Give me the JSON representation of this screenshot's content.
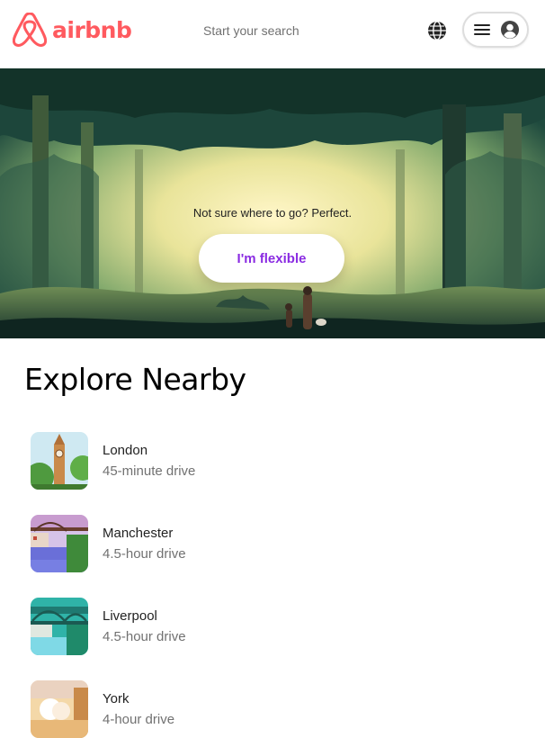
{
  "header": {
    "brand": "airbnb",
    "search_placeholder": "Start your search",
    "icons": [
      "airbnb-logo-icon",
      "globe-icon",
      "hamburger-menu-icon",
      "user-avatar-icon"
    ],
    "brand_color": "#FF5A5F"
  },
  "hero": {
    "tagline": "Not sure where to go? Perfect.",
    "cta_label": "I'm flexible",
    "cta_color": "#8A2BE2"
  },
  "explore": {
    "title": "Explore Nearby",
    "items": [
      {
        "city": "London",
        "drive": "45-minute drive"
      },
      {
        "city": "Manchester",
        "drive": "4.5-hour drive"
      },
      {
        "city": "Liverpool",
        "drive": "4.5-hour drive"
      },
      {
        "city": "York",
        "drive": "4-hour drive"
      }
    ]
  }
}
